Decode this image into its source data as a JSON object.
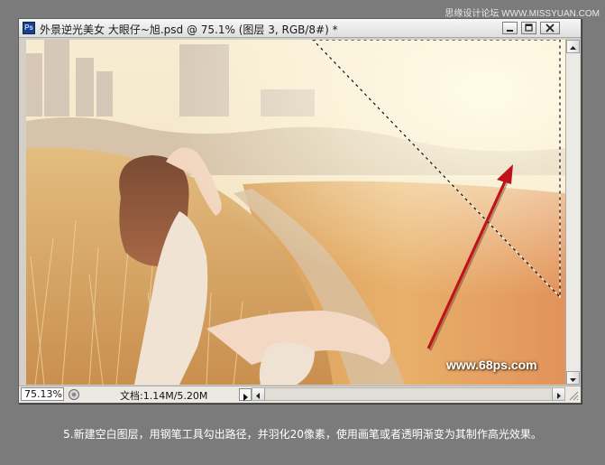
{
  "watermark": "思缘设计论坛 WWW.MISSYUAN.COM",
  "window": {
    "app_icon": "Ps",
    "title": "外景逆光美女  大眼仔~旭.psd @ 75.1% (图层 3, RGB/8#) *",
    "buttons": [
      "minimize-icon",
      "maximize-icon",
      "close-icon"
    ]
  },
  "canvas": {
    "photo_watermark": "www.68ps.com",
    "annotations": {
      "selection": "dashed-marquee-path",
      "arrow_color": "#c0121a"
    }
  },
  "status": {
    "zoom": "75.13%",
    "doc_info": "文档:1.14M/5.20M"
  },
  "caption": "5.新建空白图层，用钢笔工具勾出路径，并羽化20像素，使用画笔或者透明渐变为其制作高光效果。"
}
